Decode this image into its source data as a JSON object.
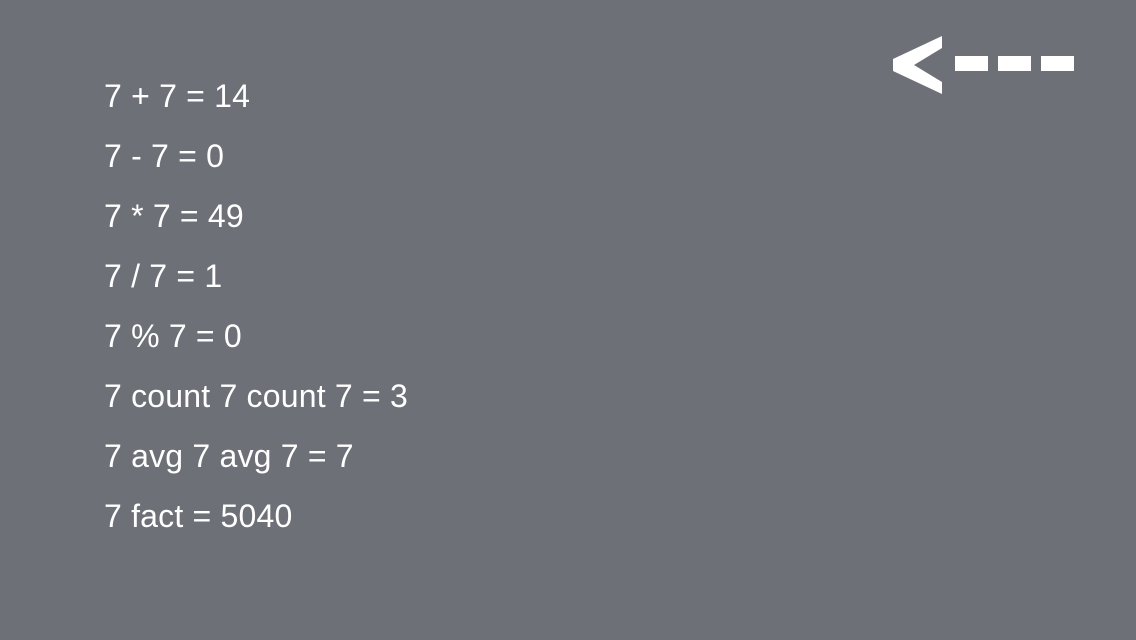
{
  "back_button": {
    "icon": "back-arrow-icon",
    "label": "<---",
    "color": "#ffffff"
  },
  "history": [
    {
      "expression": "7 + 7 = 14"
    },
    {
      "expression": "7 - 7 = 0"
    },
    {
      "expression": "7 * 7 = 49"
    },
    {
      "expression": "7 / 7 = 1"
    },
    {
      "expression": "7 % 7 = 0"
    },
    {
      "expression": "7 count 7 count 7 = 3"
    },
    {
      "expression": "7 avg 7 avg 7 = 7"
    },
    {
      "expression": "7 fact = 5040"
    }
  ],
  "colors": {
    "background": "#6e7078",
    "text": "#ffffff"
  }
}
